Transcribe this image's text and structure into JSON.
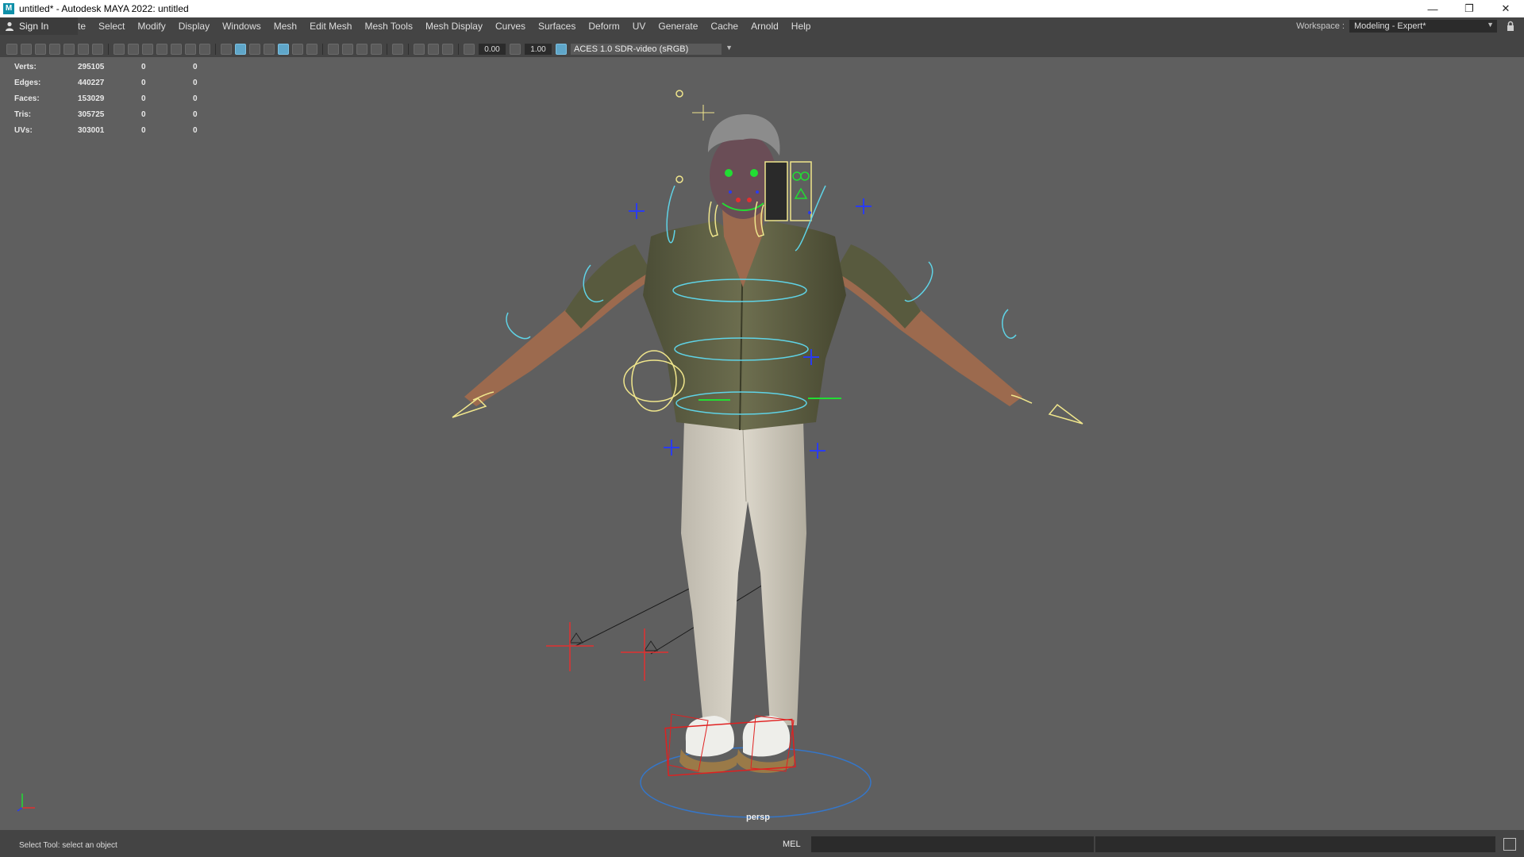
{
  "window": {
    "app_icon": "M",
    "title": "untitled* - Autodesk MAYA 2022: untitled",
    "controls": [
      "minimize-icon",
      "restore-icon",
      "close-icon"
    ]
  },
  "menubar": {
    "sign_in": "Sign In",
    "truncated_item": "te",
    "items": [
      "Select",
      "Modify",
      "Display",
      "Windows",
      "Mesh",
      "Edit Mesh",
      "Mesh Tools",
      "Mesh Display",
      "Curves",
      "Surfaces",
      "Deform",
      "UV",
      "Generate",
      "Cache",
      "Arnold",
      "Help"
    ]
  },
  "workspace": {
    "label": "Workspace :",
    "value": "Modeling - Expert*"
  },
  "toolbar": {
    "exposure": "0.00",
    "gamma": "1.00",
    "color_space": "ACES 1.0 SDR-video (sRGB)"
  },
  "hud": {
    "rows": [
      {
        "label": "Verts:",
        "v1": "295105",
        "v2": "0",
        "v3": "0"
      },
      {
        "label": "Edges:",
        "v1": "440227",
        "v2": "0",
        "v3": "0"
      },
      {
        "label": "Faces:",
        "v1": "153029",
        "v2": "0",
        "v3": "0"
      },
      {
        "label": "Tris:",
        "v1": "305725",
        "v2": "0",
        "v3": "0"
      },
      {
        "label": "UVs:",
        "v1": "303001",
        "v2": "0",
        "v3": "0"
      }
    ]
  },
  "viewport": {
    "camera_label": "persp"
  },
  "status": {
    "message": "Select Tool: select an object",
    "mel_label": "MEL"
  },
  "colors": {
    "viewport_bg": "#5f5f5f",
    "ui_bg": "#444444",
    "rig_yellow": "#f0e68c",
    "rig_cyan": "#5fd3e6",
    "rig_red": "#e03030",
    "rig_blue": "#2a3cf0",
    "rig_green": "#22dd33"
  }
}
